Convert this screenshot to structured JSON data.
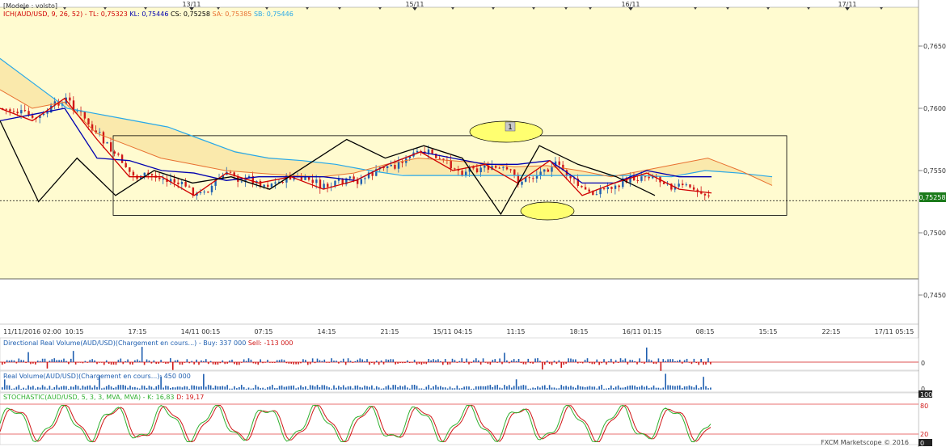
{
  "header": {
    "model_label": "[Modele : volsto]",
    "ichimoku": {
      "name": "ICH(AUD/USD, 9, 26, 52) -",
      "tl": "TL: 0,75323",
      "kl": "KL: 0,75446",
      "cs": "CS: 0,75258",
      "sa": "SA: 0,75385",
      "sb": "SB: 0,75446"
    },
    "colors": {
      "tl": "#d00000",
      "kl": "#0000b0",
      "cs": "#000000",
      "sa": "#e87030",
      "sb": "#28a8e8",
      "candle_up": "#1f5fb0",
      "candle_down": "#d01818",
      "cloud": "#f8e3a0",
      "background": "#fffbd0"
    }
  },
  "top_date_labels": [
    "13/11",
    "15/11",
    "16/11",
    "17/11"
  ],
  "annotation_label": "1",
  "current_price": "0,75258",
  "price_axis_labels": [
    "0,7650",
    "0,7600",
    "0,7550",
    "0,7500",
    "0,7450"
  ],
  "time_axis_labels": [
    "11/11/2016 02:00",
    "10:15",
    "17:15",
    "14/11 00:15",
    "07:15",
    "14:15",
    "21:15",
    "15/11 04:15",
    "11:15",
    "18:15",
    "16/11 01:15",
    "08:15",
    "15:15",
    "22:15",
    "17/11 05:15"
  ],
  "directional_volume": {
    "label": "Directional Real Volume(AUD/USD)(Chargement en cours...) -",
    "buy": "Buy: 337 000",
    "sell": "Sell: -113 000",
    "axis_label": "0"
  },
  "real_volume": {
    "label": "Real Volume(AUD/USD)(Chargement en cours...): 450 000",
    "axis_label": "0"
  },
  "stochastic": {
    "label": "STOCHASTIC(AUD/USD, 5, 3, 3, MVA, MVA) -",
    "k": "K: 16,83",
    "d": "D: 19,17",
    "axis_labels": [
      "100",
      "80",
      "20",
      "0"
    ]
  },
  "copyright": "FXCM Marketscope © 2016",
  "chart_data": {
    "type": "candlestick",
    "symbol": "AUD/USD",
    "ylim": [
      0.742,
      0.768
    ],
    "x_range": [
      "11/11/2016 02:00",
      "17/11 05:15"
    ],
    "horizontal_line": 0.75258,
    "range_box": {
      "high": 0.7578,
      "low": 0.7514
    },
    "series": [
      {
        "name": "TL",
        "values": [
          0.76,
          0.759,
          0.7608,
          0.7575,
          0.7545,
          0.7545,
          0.753,
          0.7548,
          0.754,
          0.7545,
          0.7535,
          0.7542,
          0.7555,
          0.7565,
          0.755,
          0.7555,
          0.754,
          0.7558,
          0.753,
          0.754,
          0.7548,
          0.7535,
          0.7532
        ]
      },
      {
        "name": "KL",
        "values": [
          0.759,
          0.7595,
          0.76,
          0.756,
          0.7558,
          0.755,
          0.7548,
          0.7542,
          0.7545,
          0.7545,
          0.7545,
          0.7542,
          0.7555,
          0.7565,
          0.756,
          0.7555,
          0.7555,
          0.7558,
          0.754,
          0.754,
          0.755,
          0.7545,
          0.7545
        ]
      },
      {
        "name": "CS",
        "values": [
          0.759,
          0.7525,
          0.756,
          0.753,
          0.755,
          0.754,
          0.7545,
          0.7535,
          0.7555,
          0.7575,
          0.756,
          0.757,
          0.756,
          0.7515,
          0.757,
          0.7555,
          0.7545,
          0.753
        ]
      },
      {
        "name": "SA",
        "values": [
          0.7615,
          0.76,
          0.7605,
          0.758,
          0.757,
          0.756,
          0.7555,
          0.755,
          0.7548,
          0.7546,
          0.7545,
          0.7548,
          0.7555,
          0.756,
          0.7558,
          0.7556,
          0.7553,
          0.7554,
          0.755,
          0.7545,
          0.755,
          0.7555,
          0.756,
          0.755,
          0.7538
        ]
      },
      {
        "name": "SB",
        "values": [
          0.764,
          0.762,
          0.76,
          0.7595,
          0.759,
          0.7585,
          0.7575,
          0.7565,
          0.756,
          0.7558,
          0.7555,
          0.755,
          0.7546,
          0.7546,
          0.7546,
          0.7546,
          0.7546,
          0.7546,
          0.7546,
          0.7546,
          0.7545,
          0.755,
          0.7548,
          0.7545
        ]
      }
    ],
    "stochastic_levels": [
      80,
      20
    ]
  }
}
